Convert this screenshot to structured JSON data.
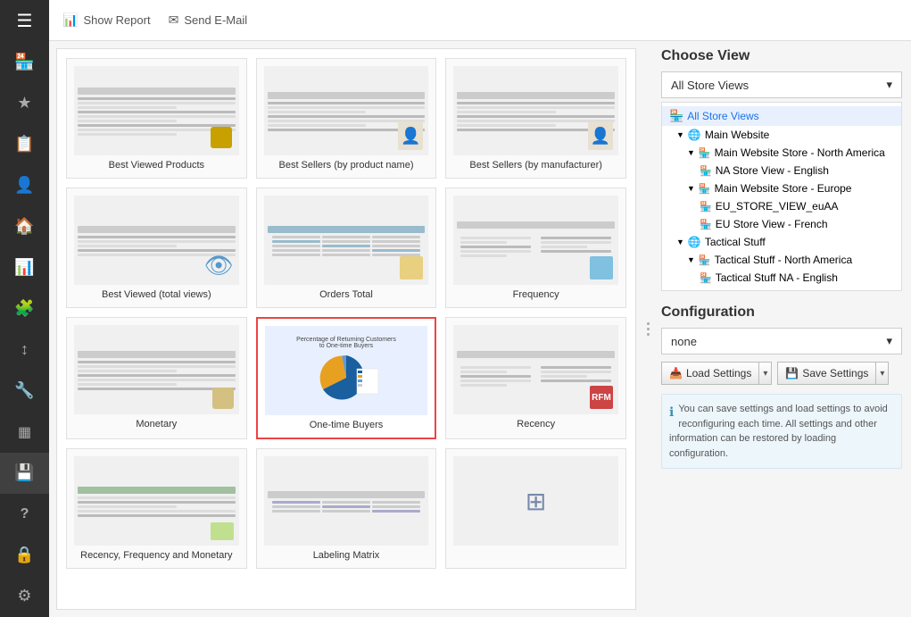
{
  "sidebar": {
    "items": [
      {
        "id": "hamburger",
        "icon": "☰",
        "label": "Menu"
      },
      {
        "id": "store",
        "icon": "🏪",
        "label": "Store"
      },
      {
        "id": "star",
        "icon": "★",
        "label": "Favorites"
      },
      {
        "id": "reports",
        "icon": "📋",
        "label": "Reports"
      },
      {
        "id": "user",
        "icon": "👤",
        "label": "Users"
      },
      {
        "id": "home",
        "icon": "🏠",
        "label": "Home"
      },
      {
        "id": "chart",
        "icon": "📊",
        "label": "Charts"
      },
      {
        "id": "puzzle",
        "icon": "🧩",
        "label": "Extensions"
      },
      {
        "id": "arrows",
        "icon": "↕",
        "label": "Transfers"
      },
      {
        "id": "wrench",
        "icon": "🔧",
        "label": "Settings"
      },
      {
        "id": "layers",
        "icon": "▦",
        "label": "Layers"
      },
      {
        "id": "save",
        "icon": "💾",
        "label": "Save",
        "active": true
      },
      {
        "id": "help",
        "icon": "?",
        "label": "Help"
      },
      {
        "id": "lock",
        "icon": "🔒",
        "label": "Lock"
      },
      {
        "id": "gear",
        "icon": "⚙",
        "label": "Gear"
      }
    ]
  },
  "toolbar": {
    "show_report_label": "Show Report",
    "send_email_label": "Send E-Mail"
  },
  "reports": {
    "cards": [
      {
        "id": "best-viewed",
        "title": "Best Viewed Products",
        "type": "list",
        "selected": false
      },
      {
        "id": "best-sellers-name",
        "title": "Best Sellers (by product name)",
        "type": "list",
        "selected": false
      },
      {
        "id": "best-sellers-mfr",
        "title": "Best Sellers (by manufacturer)",
        "type": "list",
        "selected": false
      },
      {
        "id": "best-viewed-total",
        "title": "Best Viewed (total views)",
        "type": "list2",
        "selected": false
      },
      {
        "id": "orders-total",
        "title": "Orders Total",
        "type": "table",
        "selected": false
      },
      {
        "id": "frequency",
        "title": "Frequency",
        "type": "form",
        "selected": false
      },
      {
        "id": "monetary",
        "title": "Monetary",
        "type": "list3",
        "selected": false
      },
      {
        "id": "one-time-buyers",
        "title": "One-time Buyers",
        "type": "pie",
        "selected": true
      },
      {
        "id": "recency",
        "title": "Recency",
        "type": "form2",
        "selected": false
      },
      {
        "id": "rfm-recency",
        "title": "Recency, Frequency and Monetary",
        "type": "list4",
        "selected": false
      },
      {
        "id": "labeling-matrix",
        "title": "Labeling Matrix",
        "type": "table2",
        "selected": false
      },
      {
        "id": "extra",
        "title": "",
        "type": "table3",
        "selected": false
      }
    ]
  },
  "right_panel": {
    "choose_view_title": "Choose View",
    "configuration_title": "Configuration",
    "dropdown_value": "All Store Views",
    "dropdown_arrow": "▾",
    "tree": {
      "items": [
        {
          "id": "all-store",
          "label": "All Store Views",
          "indent": 0,
          "type": "store-icon",
          "selected": true
        },
        {
          "id": "main-website",
          "label": "Main Website",
          "indent": 1,
          "type": "globe",
          "expand": true
        },
        {
          "id": "mws-north-america",
          "label": "Main Website Store - North America",
          "indent": 2,
          "type": "store",
          "expand": true
        },
        {
          "id": "na-english",
          "label": "NA Store View - English",
          "indent": 3,
          "type": "store-view"
        },
        {
          "id": "mws-europe",
          "label": "Main Website Store - Europe",
          "indent": 2,
          "type": "store",
          "expand": true
        },
        {
          "id": "eu-store-view",
          "label": "EU_STORE_VIEW_euAA",
          "indent": 3,
          "type": "store-view"
        },
        {
          "id": "eu-french",
          "label": "EU Store View - French",
          "indent": 3,
          "type": "store-view"
        },
        {
          "id": "tactical-stuff",
          "label": "Tactical Stuff",
          "indent": 1,
          "type": "globe",
          "expand": true
        },
        {
          "id": "ts-north-america",
          "label": "Tactical Stuff - North America",
          "indent": 2,
          "type": "store",
          "expand": true
        },
        {
          "id": "ts-na-english",
          "label": "Tactical Stuff NA - English",
          "indent": 3,
          "type": "store-view"
        }
      ]
    },
    "config": {
      "none_label": "none",
      "load_settings_label": "Load Settings",
      "save_settings_label": "Save Settings",
      "info_text": "You can save settings and load settings to avoid reconfiguring each time. All settings and other information can be restored by loading configuration."
    }
  }
}
